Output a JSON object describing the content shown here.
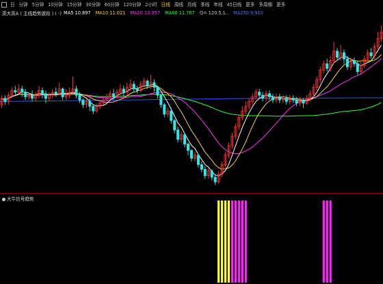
{
  "toolbar": {
    "periods": [
      "日",
      "分钟",
      "5分钟",
      "10分钟",
      "15分钟",
      "30分钟",
      "60分钟",
      "120分钟",
      "2小时",
      "日线",
      "周线",
      "月线",
      "季线",
      "年线",
      "45日线",
      "更多",
      "多周期",
      "更多"
    ],
    "active_period": "日线"
  },
  "info": {
    "title": "英大高A ( 主线趋势波段 ) ( -)",
    "ma": [
      {
        "label": "MA5 10.897",
        "color": "#ffffff"
      },
      {
        "label": "MA10 11.021",
        "color": "#ffd633"
      },
      {
        "label": "MA20 10.957",
        "color": "#ff33ff"
      },
      {
        "label": "MA60 11.767",
        "color": "#33ff33"
      },
      {
        "label": "Q= 120.5.1..",
        "color": "#cccccc"
      },
      {
        "label": "MA250 9.910",
        "color": "#5577ff"
      }
    ]
  },
  "sub_panel": {
    "title": "大牛信号趋势"
  },
  "colors": {
    "up": "#ff3333",
    "down": "#33e6e6",
    "ma5": "#ffffff",
    "ma10": "#ffd633",
    "ma20": "#ff33ff",
    "ma60": "#33ff33",
    "ma250": "#3355ff",
    "signal_yellow": "#ffff22",
    "signal_magenta": "#ff22ff"
  },
  "chart_data": {
    "type": "candlestick",
    "candles": [
      [
        10.8,
        11.0,
        11.1,
        10.7
      ],
      [
        11.0,
        10.9,
        11.1,
        10.8
      ],
      [
        10.9,
        11.1,
        11.2,
        10.8
      ],
      [
        11.1,
        11.25,
        11.35,
        11.0
      ],
      [
        11.25,
        11.2,
        11.4,
        11.1
      ],
      [
        11.2,
        11.3,
        11.45,
        11.1
      ],
      [
        11.3,
        11.2,
        11.4,
        11.05
      ],
      [
        11.2,
        11.05,
        11.3,
        10.95
      ],
      [
        11.05,
        11.1,
        11.2,
        10.95
      ],
      [
        11.1,
        11.0,
        11.25,
        10.9
      ],
      [
        11.0,
        11.1,
        11.2,
        10.9
      ],
      [
        11.1,
        11.25,
        11.4,
        11.0
      ],
      [
        11.25,
        11.15,
        11.35,
        11.0
      ],
      [
        11.15,
        11.0,
        11.25,
        10.85
      ],
      [
        11.0,
        11.1,
        11.2,
        10.9
      ],
      [
        11.1,
        11.2,
        11.3,
        11.0
      ],
      [
        11.2,
        11.15,
        11.35,
        11.05
      ],
      [
        11.15,
        11.3,
        11.5,
        11.1
      ],
      [
        11.3,
        11.05,
        11.35,
        10.95
      ],
      [
        11.05,
        11.1,
        11.3,
        10.95
      ],
      [
        11.1,
        11.2,
        11.35,
        11.0
      ],
      [
        11.2,
        11.3,
        11.7,
        11.1
      ],
      [
        11.3,
        11.1,
        11.4,
        11.0
      ],
      [
        11.1,
        10.95,
        11.2,
        10.85
      ],
      [
        10.95,
        10.8,
        11.0,
        10.7
      ],
      [
        10.8,
        10.9,
        11.0,
        10.7
      ],
      [
        10.9,
        10.75,
        11.0,
        10.6
      ],
      [
        10.75,
        10.6,
        10.8,
        10.5
      ],
      [
        10.6,
        10.75,
        10.85,
        10.55
      ],
      [
        10.75,
        10.85,
        10.95,
        10.65
      ],
      [
        10.85,
        10.95,
        11.05,
        10.8
      ],
      [
        10.95,
        11.05,
        11.15,
        10.85
      ],
      [
        11.05,
        11.15,
        11.25,
        10.95
      ],
      [
        11.15,
        11.05,
        11.3,
        10.95
      ],
      [
        11.05,
        11.2,
        11.3,
        11.0
      ],
      [
        11.2,
        11.3,
        11.45,
        11.1
      ],
      [
        11.3,
        11.2,
        11.4,
        11.05
      ],
      [
        11.2,
        11.35,
        11.5,
        11.1
      ],
      [
        11.35,
        11.45,
        11.6,
        11.25
      ],
      [
        11.45,
        11.3,
        11.55,
        11.2
      ],
      [
        11.3,
        11.25,
        11.4,
        11.15
      ],
      [
        11.25,
        11.45,
        11.55,
        11.2
      ],
      [
        11.45,
        11.55,
        11.65,
        11.35
      ],
      [
        11.55,
        11.4,
        11.6,
        11.3
      ],
      [
        11.4,
        11.5,
        11.75,
        11.3
      ],
      [
        11.5,
        11.35,
        11.6,
        11.2
      ],
      [
        11.35,
        11.1,
        11.4,
        11.0
      ],
      [
        11.1,
        10.8,
        11.15,
        10.7
      ],
      [
        10.8,
        10.5,
        10.85,
        10.4
      ],
      [
        10.5,
        10.6,
        10.7,
        10.4
      ],
      [
        10.6,
        10.3,
        10.7,
        10.2
      ],
      [
        10.3,
        10.0,
        10.35,
        9.9
      ],
      [
        10.0,
        9.7,
        10.1,
        9.6
      ],
      [
        9.7,
        9.85,
        9.95,
        9.6
      ],
      [
        9.85,
        9.55,
        9.9,
        9.45
      ],
      [
        9.55,
        9.35,
        9.6,
        9.2
      ],
      [
        9.35,
        9.1,
        9.4,
        9.0
      ],
      [
        9.1,
        9.2,
        9.3,
        9.0
      ],
      [
        9.2,
        8.9,
        9.25,
        8.8
      ],
      [
        8.9,
        8.75,
        9.0,
        8.65
      ],
      [
        8.75,
        8.55,
        8.85,
        8.45
      ],
      [
        8.55,
        8.7,
        8.8,
        8.45
      ],
      [
        8.7,
        8.5,
        8.75,
        8.4
      ],
      [
        8.5,
        8.35,
        8.6,
        8.25
      ],
      [
        8.35,
        8.6,
        8.7,
        8.3
      ],
      [
        8.6,
        8.9,
        9.0,
        8.5
      ],
      [
        8.9,
        9.2,
        9.3,
        8.8
      ],
      [
        9.2,
        9.5,
        9.6,
        9.1
      ],
      [
        9.5,
        9.8,
        9.9,
        9.4
      ],
      [
        9.8,
        10.1,
        10.2,
        9.7
      ],
      [
        10.1,
        10.4,
        10.5,
        10.0
      ],
      [
        10.4,
        10.6,
        10.75,
        10.3
      ],
      [
        10.6,
        10.75,
        10.9,
        10.5
      ],
      [
        10.75,
        10.9,
        11.0,
        10.65
      ],
      [
        10.9,
        11.05,
        11.15,
        10.8
      ],
      [
        11.05,
        11.2,
        11.3,
        10.95
      ],
      [
        11.2,
        11.1,
        11.3,
        11.0
      ],
      [
        11.1,
        11.0,
        11.2,
        10.9
      ],
      [
        11.0,
        11.15,
        11.25,
        10.9
      ],
      [
        11.15,
        11.05,
        11.25,
        10.95
      ],
      [
        11.05,
        10.95,
        11.15,
        10.85
      ],
      [
        10.95,
        11.05,
        11.15,
        10.85
      ],
      [
        11.05,
        10.95,
        11.15,
        10.85
      ],
      [
        10.95,
        11.0,
        11.1,
        10.85
      ],
      [
        11.0,
        10.9,
        11.1,
        10.8
      ],
      [
        10.9,
        11.0,
        11.1,
        10.8
      ],
      [
        11.0,
        10.95,
        11.1,
        10.85
      ],
      [
        10.95,
        10.85,
        11.05,
        10.75
      ],
      [
        10.85,
        10.95,
        11.05,
        10.75
      ],
      [
        10.95,
        10.85,
        11.0,
        10.7
      ],
      [
        10.85,
        11.0,
        11.1,
        10.8
      ],
      [
        11.0,
        11.15,
        11.25,
        10.9
      ],
      [
        11.15,
        11.35,
        11.45,
        11.05
      ],
      [
        11.35,
        11.6,
        11.7,
        11.25
      ],
      [
        11.6,
        11.9,
        12.0,
        11.5
      ],
      [
        11.9,
        12.1,
        12.2,
        11.8
      ],
      [
        12.1,
        11.95,
        12.25,
        11.85
      ],
      [
        11.95,
        12.2,
        12.35,
        11.85
      ],
      [
        12.2,
        12.5,
        12.8,
        12.1
      ],
      [
        12.5,
        12.3,
        12.6,
        12.2
      ],
      [
        12.3,
        12.45,
        12.7,
        12.2
      ],
      [
        12.45,
        12.25,
        12.55,
        12.1
      ],
      [
        12.25,
        12.0,
        12.35,
        11.9
      ],
      [
        12.0,
        12.2,
        12.3,
        11.9
      ],
      [
        12.2,
        12.1,
        12.3,
        12.0
      ],
      [
        12.1,
        11.85,
        12.2,
        11.75
      ],
      [
        11.85,
        12.05,
        12.15,
        11.75
      ],
      [
        12.05,
        12.25,
        12.35,
        11.95
      ],
      [
        12.25,
        12.45,
        12.55,
        12.15
      ],
      [
        12.45,
        12.35,
        12.6,
        12.25
      ],
      [
        12.35,
        12.65,
        12.75,
        12.25
      ],
      [
        12.65,
        12.9,
        13.1,
        12.55
      ],
      [
        12.9,
        13.1,
        13.3,
        12.8
      ]
    ],
    "ma250": [
      10.9,
      10.95,
      11.0,
      11.02
    ],
    "ylim": [
      8.0,
      13.6
    ],
    "signals": [
      {
        "index": 64,
        "color": "yellow"
      },
      {
        "index": 65,
        "color": "yellow"
      },
      {
        "index": 66,
        "color": "yellow"
      },
      {
        "index": 67,
        "color": "yellow"
      },
      {
        "index": 68,
        "color": "magenta"
      },
      {
        "index": 69,
        "color": "magenta"
      },
      {
        "index": 70,
        "color": "magenta"
      },
      {
        "index": 71,
        "color": "magenta"
      },
      {
        "index": 72,
        "color": "magenta"
      },
      {
        "index": 95,
        "color": "magenta"
      },
      {
        "index": 96,
        "color": "magenta"
      },
      {
        "index": 97,
        "color": "magenta"
      }
    ]
  }
}
